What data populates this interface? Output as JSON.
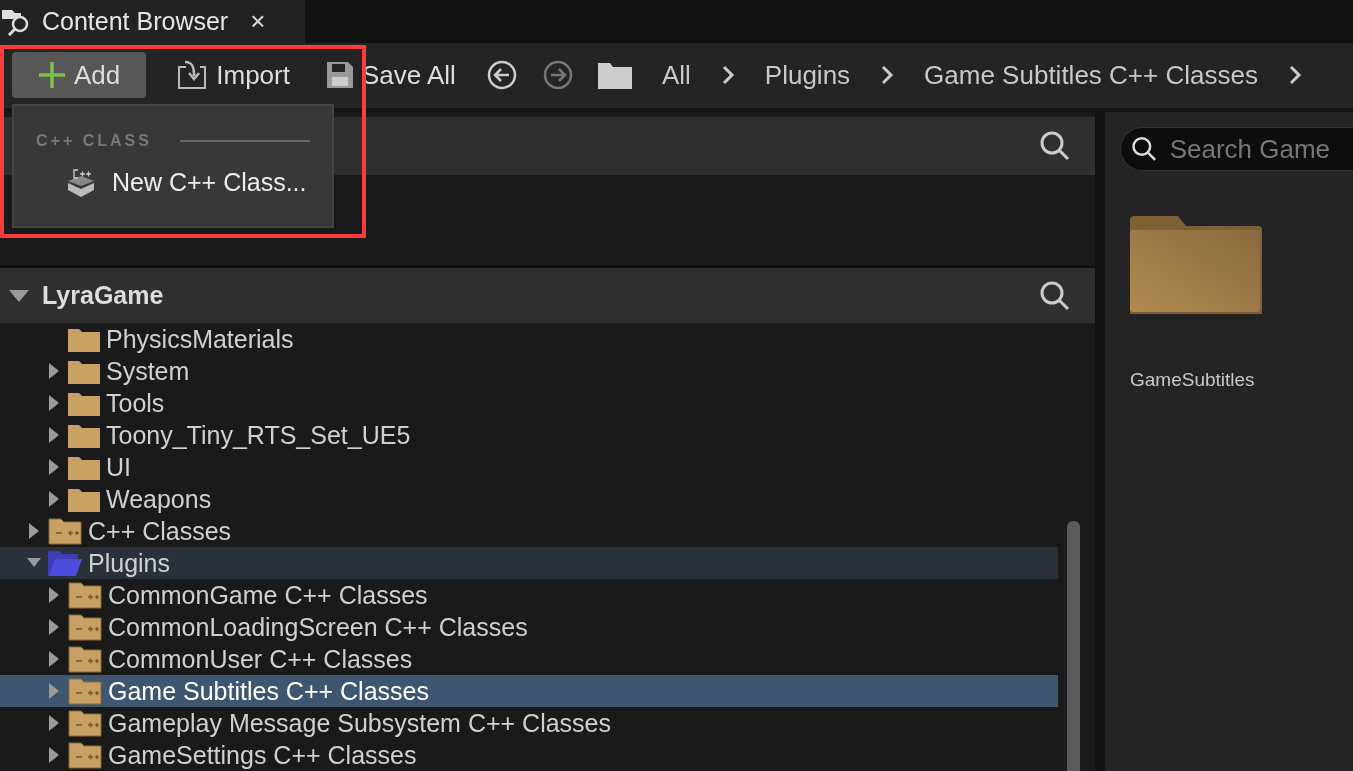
{
  "tab": {
    "title": "Content Browser",
    "close": "×"
  },
  "toolbar": {
    "buttons": [
      {
        "kind": "add",
        "label": "Add",
        "selected": true
      },
      {
        "kind": "import",
        "label": "Import",
        "selected": false
      },
      {
        "kind": "save",
        "label": "Save All",
        "selected": false
      }
    ],
    "history": [
      {
        "kind": "back",
        "disabled": false
      },
      {
        "kind": "forward",
        "disabled": true
      }
    ],
    "breadcrumbs": [
      "All",
      "Plugins",
      "Game Subtitles C++ Classes"
    ]
  },
  "add_menu": {
    "section": "C++ CLASS",
    "items": [
      "New C++ Class..."
    ]
  },
  "tree": {
    "root": "LyraGame",
    "items": [
      {
        "kind": "group",
        "children": [
          {
            "label": "PhysicsMaterials",
            "kind": "folder",
            "expandable": false,
            "selected": false,
            "highlighted": false
          },
          {
            "label": "System",
            "kind": "folder",
            "expandable": true,
            "expanded": false,
            "selected": false,
            "highlighted": false
          },
          {
            "label": "Tools",
            "kind": "folder",
            "expandable": true,
            "expanded": false,
            "selected": false,
            "highlighted": false
          },
          {
            "label": "Toony_Tiny_RTS_Set_UE5",
            "kind": "folder",
            "expandable": true,
            "expanded": false,
            "selected": false,
            "highlighted": false
          },
          {
            "label": "UI",
            "kind": "folder",
            "expandable": true,
            "expanded": false,
            "selected": false,
            "highlighted": false
          },
          {
            "label": "Weapons",
            "kind": "folder",
            "expandable": true,
            "expanded": false,
            "selected": false,
            "highlighted": false
          }
        ]
      },
      {
        "label": "C++ Classes",
        "kind": "cpp",
        "expandable": true,
        "expanded": false,
        "selected": false,
        "highlighted": false
      },
      {
        "label": "Plugins",
        "kind": "open",
        "expandable": true,
        "expanded": true,
        "selected": false,
        "highlighted": true,
        "children": [
          {
            "label": "CommonGame C++ Classes",
            "kind": "cpp",
            "expandable": true,
            "expanded": false,
            "selected": false,
            "highlighted": false
          },
          {
            "label": "CommonLoadingScreen C++ Classes",
            "kind": "cpp",
            "expandable": true,
            "expanded": false,
            "selected": false,
            "highlighted": false
          },
          {
            "label": "CommonUser C++ Classes",
            "kind": "cpp",
            "expandable": true,
            "expanded": false,
            "selected": false,
            "highlighted": false
          },
          {
            "label": "Game Subtitles C++ Classes",
            "kind": "cpp",
            "expandable": true,
            "expanded": false,
            "selected": true,
            "highlighted": false
          },
          {
            "label": "Gameplay Message Subsystem C++ Classes",
            "kind": "cpp",
            "expandable": true,
            "expanded": false,
            "selected": false,
            "highlighted": false
          },
          {
            "label": "GameSettings C++ Classes",
            "kind": "cpp",
            "expandable": true,
            "expanded": false,
            "selected": false,
            "highlighted": false
          }
        ]
      }
    ]
  },
  "assets": {
    "search": {
      "placeholder": "Search Game"
    },
    "items": [
      {
        "label": "GameSubtitles",
        "kind": "folder"
      }
    ]
  }
}
